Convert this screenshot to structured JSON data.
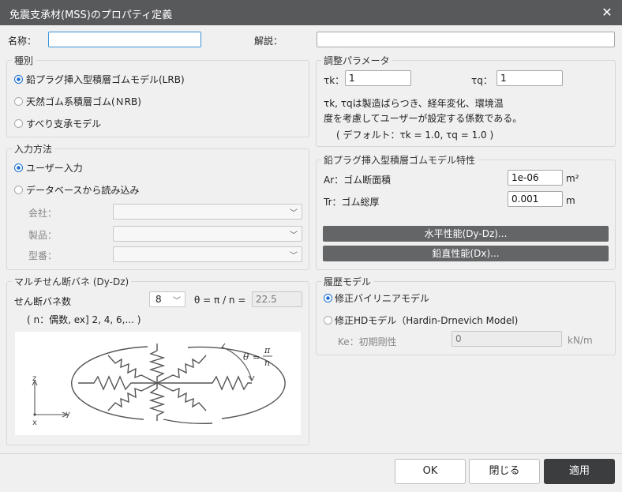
{
  "window": {
    "title": "免震支承材(MSS)のプロパティ定義",
    "close_glyph": "✕"
  },
  "top": {
    "name_label": "名称：",
    "name_value": "",
    "desc_label": "解説：",
    "desc_value": ""
  },
  "type_group": {
    "title": "種別",
    "options": [
      {
        "label": "鉛プラグ挿入型積層ゴムモデル(LRB)",
        "selected": true
      },
      {
        "label": "天然ゴム系積層ゴム(ＮRB)",
        "selected": false
      },
      {
        "label": "すべり支承モデル",
        "selected": false
      }
    ]
  },
  "input_group": {
    "title": "入力方法",
    "options": [
      {
        "label": "ユーザー入力",
        "selected": true
      },
      {
        "label": "データベースから読み込み",
        "selected": false
      }
    ],
    "company_label": "会社：",
    "product_label": "製品：",
    "model_label": "型番："
  },
  "spring_group": {
    "title": "マルチせん断バネ (Dy-Dz)",
    "count_label": "せん断バネ数",
    "count_value": "8",
    "theta_label": "θ = π / n =",
    "theta_value": "22.5",
    "note": "( n：偶数, ex] 2, 4, 6,... )",
    "fig": {
      "theta": "θ",
      "pi": "π",
      "n": "n",
      "eq": "=",
      "axis_z": "z",
      "axis_y": "y",
      "axis_x": "x"
    }
  },
  "adjust_group": {
    "title": "調整パラメータ",
    "tk_label": "τk：",
    "tk_value": "1",
    "tq_label": "τq：",
    "tq_value": "1",
    "desc_line1": "τk, τqは製造ばらつき、経年変化、環境温",
    "desc_line2": "度を考慮してユーザーが設定する係数である。",
    "desc_line3": "( デフォルト：τk = 1.0, τq = 1.0 )"
  },
  "lrb_group": {
    "title": "鉛プラグ挿入型積層ゴムモデル特性",
    "ar_label": "Ar：ゴム断面積",
    "ar_value": "1e-06",
    "ar_unit": "m²",
    "tr_label": "Tr：ゴム総厚",
    "tr_value": "0.001",
    "tr_unit": "m",
    "horiz_button": "水平性能(Dy-Dz)...",
    "vert_button": "鉛直性能(Dx)..."
  },
  "hysteresis_group": {
    "title": "履歴モデル",
    "options": [
      {
        "label": "修正バイリニアモデル",
        "selected": true
      },
      {
        "label": "修正HDモデル（Hardin-Drnevich Model)",
        "selected": false
      }
    ],
    "ke_label": "Ke：初期剛性",
    "ke_value": "0",
    "ke_unit": "kN/m"
  },
  "footer": {
    "ok": "OK",
    "close": "閉じる",
    "apply": "適用"
  }
}
